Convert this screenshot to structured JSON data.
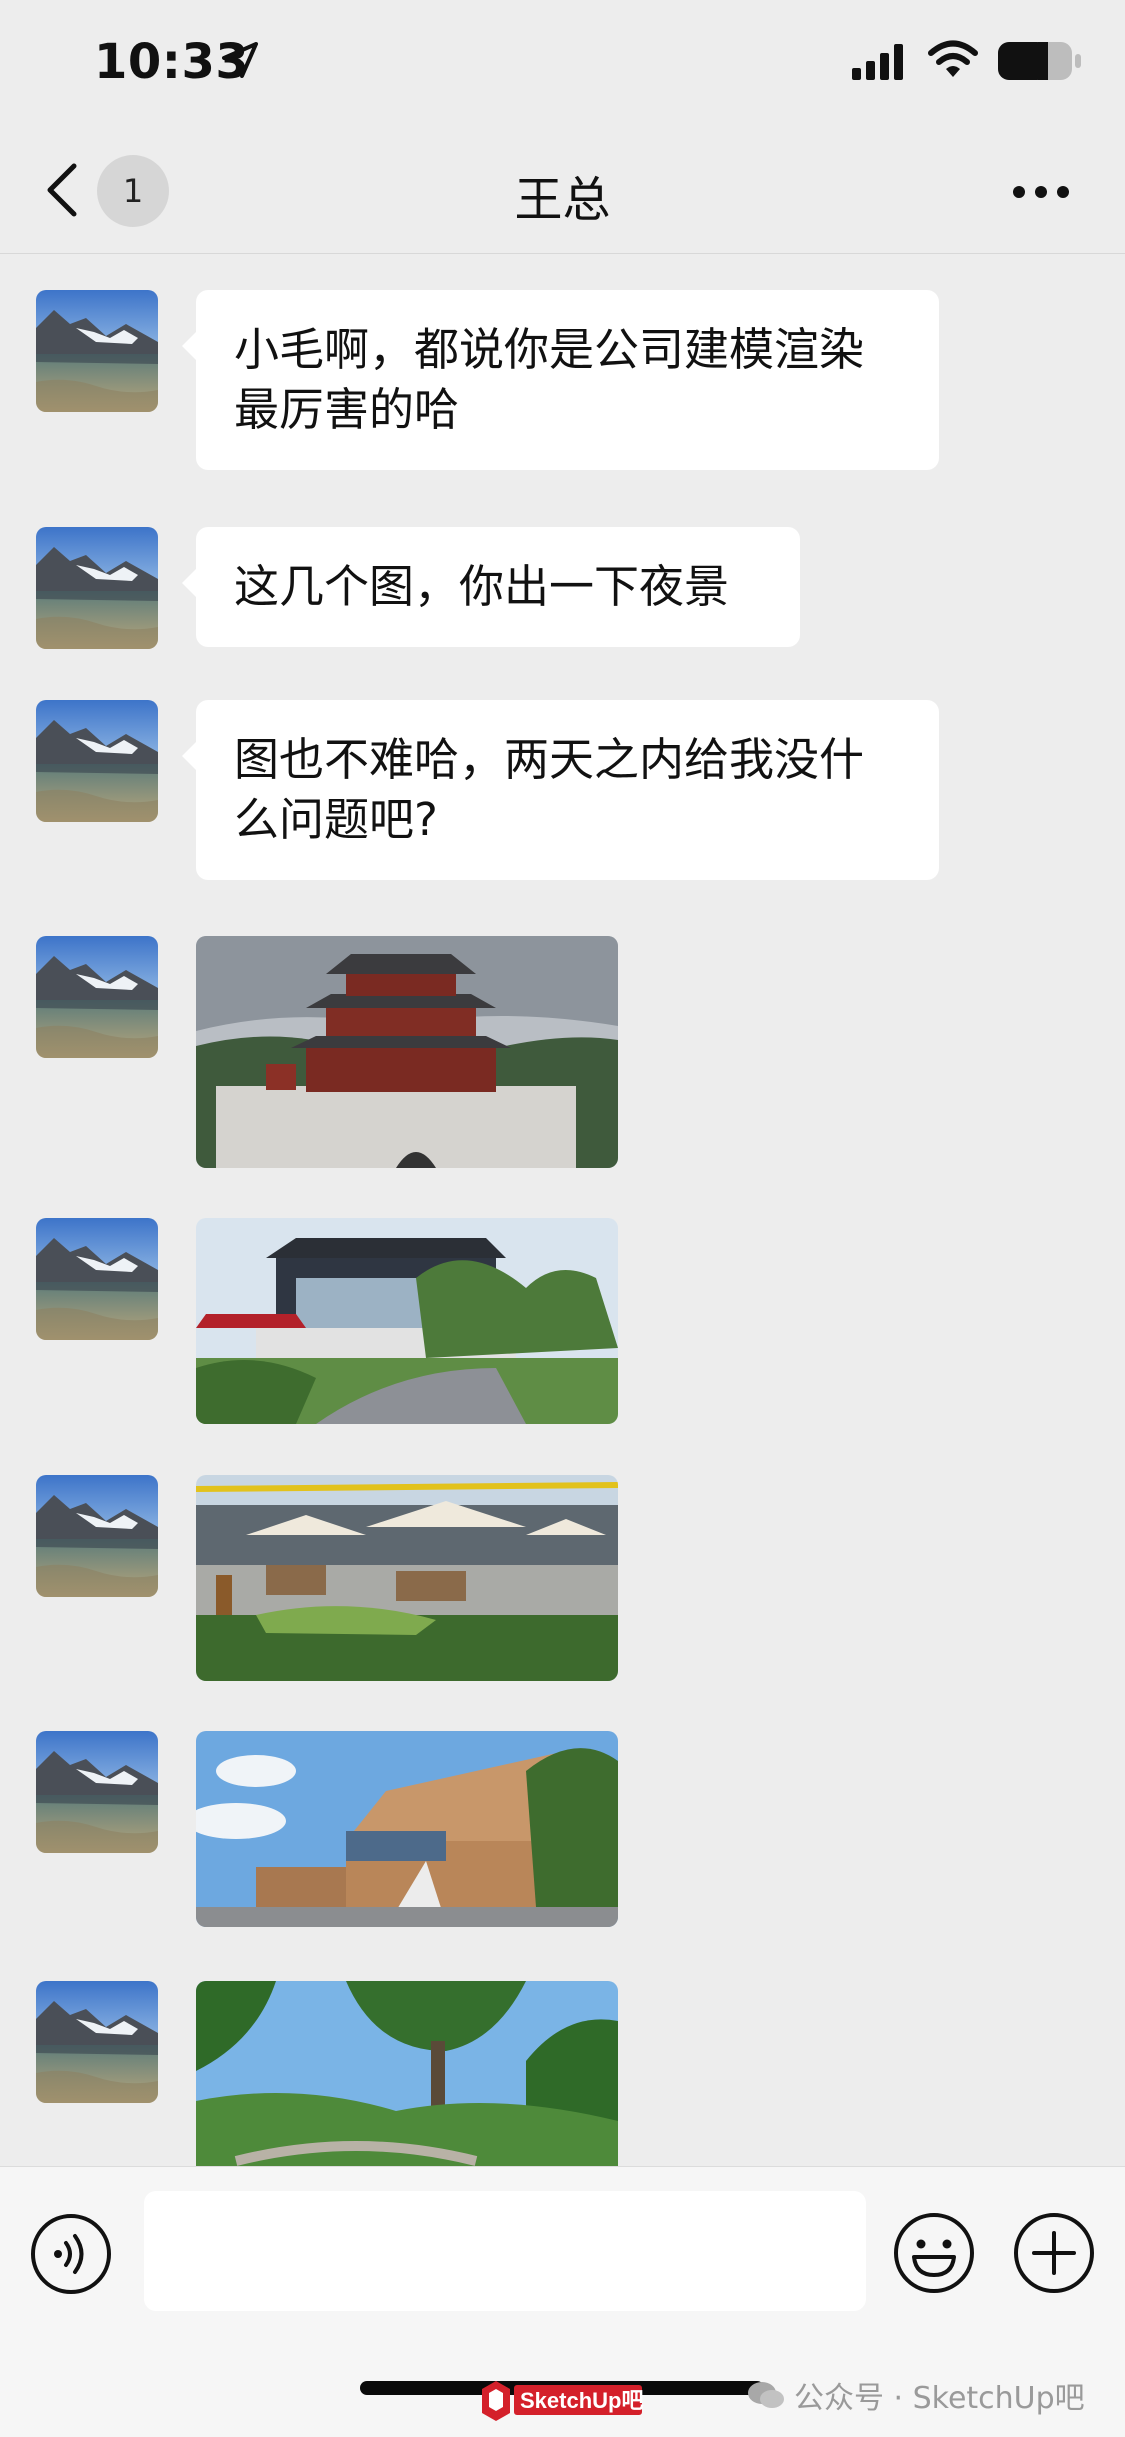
{
  "status_bar": {
    "time": "10:33"
  },
  "nav": {
    "unread_count": "1",
    "title": "王总"
  },
  "messages": [
    {
      "type": "text",
      "text": "小毛啊，都说你是公司建模渲染最厉害的哈"
    },
    {
      "type": "text",
      "text": "这几个图，你出一下夜景"
    },
    {
      "type": "text",
      "text": "图也不难哈，两天之内给我没什么问题吧?"
    },
    {
      "type": "image",
      "subject": "traditional Chinese pavilion on stone base"
    },
    {
      "type": "image",
      "subject": "modern pavilion with garden and red umbrellas"
    },
    {
      "type": "image",
      "subject": "outdoor cafe plaza with parasols"
    },
    {
      "type": "image",
      "subject": "timber clad modern building"
    },
    {
      "type": "image",
      "subject": "garden with trees"
    }
  ],
  "input_bar": {
    "placeholder": ""
  },
  "watermark": {
    "logo_text": "SketchUp吧",
    "text": "公众号 · SketchUp吧"
  },
  "colors": {
    "background": "#ededed",
    "bubble": "#ffffff",
    "badge": "#d6d6d6"
  },
  "icons": [
    "location-arrow-icon",
    "signal-icon",
    "wifi-icon",
    "battery-icon",
    "back-chevron-icon",
    "more-dots-icon",
    "voice-icon",
    "emoji-icon",
    "plus-icon"
  ]
}
